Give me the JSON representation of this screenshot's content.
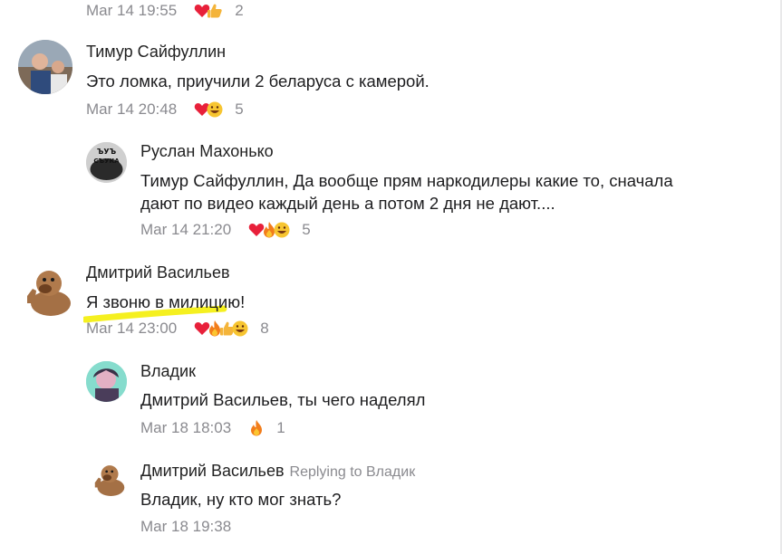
{
  "comments": [
    {
      "time": "Mar 14 19:55",
      "reaction_count": "2",
      "reactions": [
        "heart",
        "thumbs"
      ]
    },
    {
      "author": "Тимур Сайфуллин",
      "text": "Это ломка, приучили 2 беларуса  с камерой.",
      "time": "Mar 14 20:48",
      "reaction_count": "5",
      "reactions": [
        "heart",
        "laugh"
      ],
      "avatar": "avatar-photo"
    },
    {
      "author": "Руслан Махонько",
      "text_line1": "Тимур Сайфуллин, Да вообще прям наркодилеры какие то, сначала",
      "text_line2": "дают по видео каждый день а потом 2 дня не дают....",
      "time": "Mar 14 21:20",
      "reaction_count": "5",
      "reactions": [
        "heart",
        "fire",
        "laugh"
      ],
      "avatar": "avatar-sticker",
      "avatar_text_top": "ЪУЪ",
      "avatar_text_bottom": "СЪУКА"
    },
    {
      "author": "Дмитрий Васильев",
      "text": "Я звоню в милицию!",
      "time": "Mar 14 23:00",
      "reaction_count": "8",
      "reactions": [
        "heart",
        "fire",
        "thumbs",
        "laugh"
      ],
      "avatar": "avatar-alf"
    },
    {
      "author": "Владик",
      "text": "Дмитрий Васильев, ты чего наделял",
      "time": "Mar 18 18:03",
      "reaction_count": "1",
      "reactions": [
        "fire"
      ],
      "avatar": "avatar-anime"
    },
    {
      "author": "Дмитрий Васильев",
      "replying_to": "Replying to Владик",
      "text": "Владик, ну кто мог знать?",
      "time": "Mar 18 19:38",
      "avatar": "avatar-alf"
    }
  ],
  "colors": {
    "highlight": "#f5f020",
    "meta": "#8a8a8f",
    "divider": "#ececec"
  }
}
